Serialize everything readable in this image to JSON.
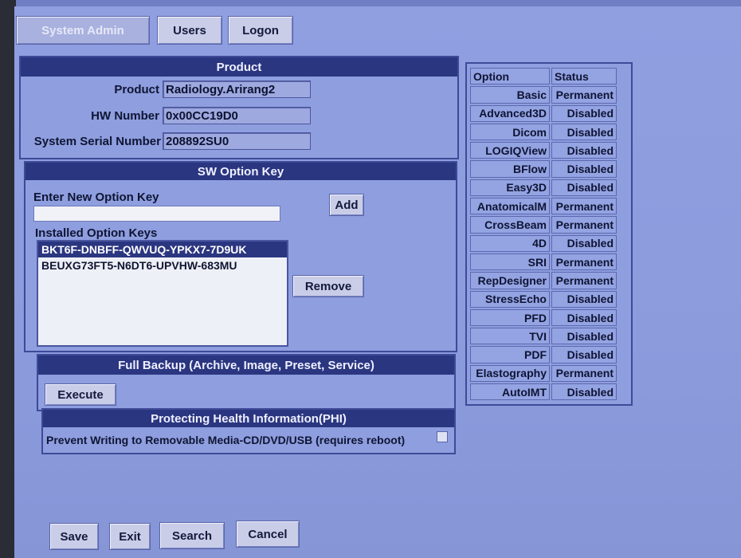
{
  "top_buttons": {
    "system_admin": "System Admin",
    "users": "Users",
    "logon": "Logon"
  },
  "product": {
    "title": "Product",
    "product_label": "Product",
    "product_value": "Radiology.Arirang2",
    "hw_label": "HW Number",
    "hw_value": "0x00CC19D0",
    "serial_label": "System Serial Number",
    "serial_value": "208892SU0"
  },
  "sw_option": {
    "title": "SW Option Key",
    "enter_label": "Enter New Option Key",
    "enter_value": "",
    "add_label": "Add",
    "installed_label": "Installed Option Keys",
    "installed_keys": [
      "BKT6F-DNBFF-QWVUQ-YPKX7-7D9UK",
      "BEUXG73FT5-N6DT6-UPVHW-683MU"
    ],
    "remove_label": "Remove"
  },
  "backup": {
    "title": "Full Backup (Archive, Image, Preset, Service)",
    "execute_label": "Execute"
  },
  "phi": {
    "title": "Protecting Health Information(PHI)",
    "checkbox_label": "Prevent Writing to Removable Media-CD/DVD/USB (requires reboot)"
  },
  "options_table": {
    "header_option": "Option",
    "header_status": "Status",
    "rows": [
      {
        "option": "Basic",
        "status": "Permanent"
      },
      {
        "option": "Advanced3D",
        "status": "Disabled"
      },
      {
        "option": "Dicom",
        "status": "Disabled"
      },
      {
        "option": "LOGIQView",
        "status": "Disabled"
      },
      {
        "option": "BFlow",
        "status": "Disabled"
      },
      {
        "option": "Easy3D",
        "status": "Disabled"
      },
      {
        "option": "AnatomicalM",
        "status": "Permanent"
      },
      {
        "option": "CrossBeam",
        "status": "Permanent"
      },
      {
        "option": "4D",
        "status": "Disabled"
      },
      {
        "option": "SRI",
        "status": "Permanent"
      },
      {
        "option": "RepDesigner",
        "status": "Permanent"
      },
      {
        "option": "StressEcho",
        "status": "Disabled"
      },
      {
        "option": "PFD",
        "status": "Disabled"
      },
      {
        "option": "TVI",
        "status": "Disabled"
      },
      {
        "option": "PDF",
        "status": "Disabled"
      },
      {
        "option": "Elastography",
        "status": "Permanent"
      },
      {
        "option": "AutoIMT",
        "status": "Disabled"
      }
    ]
  },
  "bottom_buttons": {
    "save": "Save",
    "exit": "Exit",
    "search": "Search",
    "cancel": "Cancel"
  }
}
